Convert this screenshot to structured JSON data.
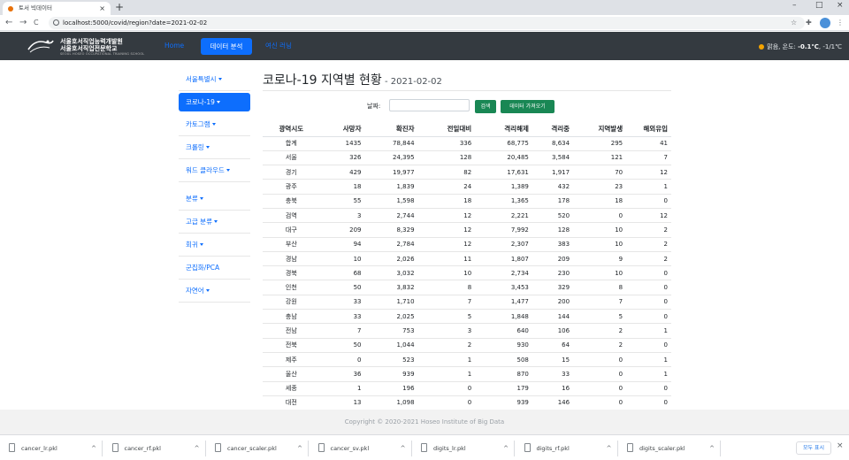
{
  "browser": {
    "tab_title": "토서 빅데이터",
    "new_tab": "+",
    "tab_close": "×",
    "url": "localhost:5000/covid/region?date=2021-02-02",
    "back": "←",
    "forward": "→",
    "reload": "C",
    "star": "☆",
    "ext": "✚",
    "menu": "⋮",
    "win_min": "–",
    "win_max": "□",
    "win_close": "×"
  },
  "navbar": {
    "logo_line1": "서울호서직업능력개발원",
    "logo_line2": "서울호서직업전문학교",
    "logo_line3": "SEOUL HOSEO OCCUPATIONAL TRAINING SCHOOL",
    "links": [
      "Home",
      "데이터 분석",
      "여신 러닝"
    ],
    "weather_prefix": "맑음, 온도: ",
    "weather_temp": "-0.1℃",
    "weather_range": ", -1/1℃"
  },
  "sidebar": {
    "items": [
      "서울특별시",
      "코로나-19",
      "카토그램",
      "크롤링",
      "워드 클라우드",
      "분류",
      "고급 분류",
      "회귀",
      "군집화/PCA",
      "자연어"
    ]
  },
  "main": {
    "title": "코로나-19 지역별 현황",
    "title_date": " - 2021-02-02",
    "date_label": "날짜:",
    "search_btn": "검색",
    "fetch_btn": "데이터 가져오기",
    "columns": [
      "광역시도",
      "사망자",
      "확진자",
      "전일대비",
      "격리해제",
      "격리중",
      "지역발생",
      "해외유입"
    ],
    "rows": [
      [
        "합계",
        "1435",
        "78,844",
        "336",
        "68,775",
        "8,634",
        "295",
        "41"
      ],
      [
        "서울",
        "326",
        "24,395",
        "128",
        "20,485",
        "3,584",
        "121",
        "7"
      ],
      [
        "경기",
        "429",
        "19,977",
        "82",
        "17,631",
        "1,917",
        "70",
        "12"
      ],
      [
        "광주",
        "18",
        "1,839",
        "24",
        "1,389",
        "432",
        "23",
        "1"
      ],
      [
        "충북",
        "55",
        "1,598",
        "18",
        "1,365",
        "178",
        "18",
        "0"
      ],
      [
        "검역",
        "3",
        "2,744",
        "12",
        "2,221",
        "520",
        "0",
        "12"
      ],
      [
        "대구",
        "209",
        "8,329",
        "12",
        "7,992",
        "128",
        "10",
        "2"
      ],
      [
        "부산",
        "94",
        "2,784",
        "12",
        "2,307",
        "383",
        "10",
        "2"
      ],
      [
        "경남",
        "10",
        "2,026",
        "11",
        "1,807",
        "209",
        "9",
        "2"
      ],
      [
        "경북",
        "68",
        "3,032",
        "10",
        "2,734",
        "230",
        "10",
        "0"
      ],
      [
        "인천",
        "50",
        "3,832",
        "8",
        "3,453",
        "329",
        "8",
        "0"
      ],
      [
        "강원",
        "33",
        "1,710",
        "7",
        "1,477",
        "200",
        "7",
        "0"
      ],
      [
        "충남",
        "33",
        "2,025",
        "5",
        "1,848",
        "144",
        "5",
        "0"
      ],
      [
        "전남",
        "7",
        "753",
        "3",
        "640",
        "106",
        "2",
        "1"
      ],
      [
        "전북",
        "50",
        "1,044",
        "2",
        "930",
        "64",
        "2",
        "0"
      ],
      [
        "제주",
        "0",
        "523",
        "1",
        "508",
        "15",
        "0",
        "1"
      ],
      [
        "울산",
        "36",
        "939",
        "1",
        "870",
        "33",
        "0",
        "1"
      ],
      [
        "세종",
        "1",
        "196",
        "0",
        "179",
        "16",
        "0",
        "0"
      ],
      [
        "대전",
        "13",
        "1,098",
        "0",
        "939",
        "146",
        "0",
        "0"
      ]
    ]
  },
  "footer": "Copyright © 2020-2021 Hoseo Institute of Big Data",
  "downloads": {
    "files": [
      "cancer_lr.pkl",
      "cancer_rf.pkl",
      "cancer_scaler.pkl",
      "cancer_sv.pkl",
      "digits_lr.pkl",
      "digits_rf.pkl",
      "digits_scaler.pkl"
    ],
    "chevron": "^",
    "show_all": "모두 표시",
    "close": "×"
  },
  "colors": {
    "navbar": "#343a40",
    "primary": "#0d6efd",
    "success": "#198754",
    "weather_icon": "#f4a300"
  },
  "icons": [
    "tab-favicon-icon",
    "back-icon",
    "forward-icon",
    "reload-icon",
    "info-icon",
    "star-icon",
    "extension-icon",
    "profile-icon",
    "menu-icon",
    "sun-icon",
    "file-icon",
    "close-icon"
  ]
}
